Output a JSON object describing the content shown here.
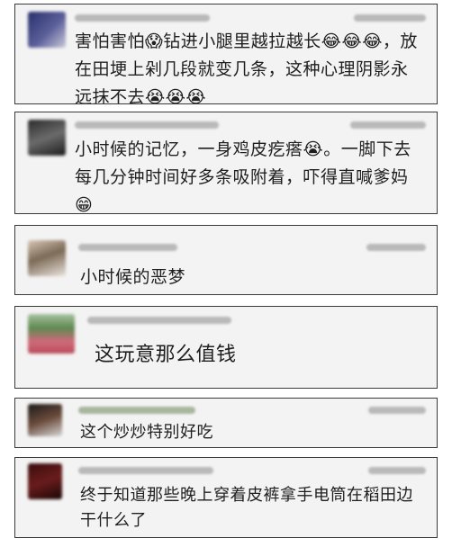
{
  "comments": [
    {
      "text": "害怕害怕😱钻进小腿里越拉越长😂😂😂，放在田埂上剁几段就变几条，这种心理阴影永远抹不去😭😭😭"
    },
    {
      "text": "小时候的记忆，一身鸡皮疙瘩😭。一脚下去每几分钟时间好多条吸附着，吓得直喊爹妈😁"
    },
    {
      "text": "小时候的恶梦"
    },
    {
      "text": "这玩意那么值钱"
    },
    {
      "text": "这个炒炒特别好吃"
    },
    {
      "text": "终于知道那些晚上穿着皮裤拿手电筒在稻田边干什么了"
    }
  ]
}
